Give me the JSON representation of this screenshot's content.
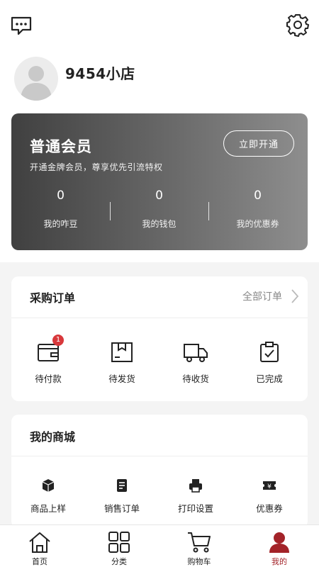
{
  "header": {
    "message_icon": "chat-bubble-icon",
    "settings_icon": "gear-icon"
  },
  "profile": {
    "shop_name": "9454小店",
    "avatar_icon": "default-avatar-icon"
  },
  "member_card": {
    "title": "普通会员",
    "subtitle": "开通金牌会员，尊享优先引流特权",
    "cta_label": "立即开通",
    "stats": [
      {
        "value": "0",
        "label": "我的咋豆"
      },
      {
        "value": "0",
        "label": "我的钱包"
      },
      {
        "value": "0",
        "label": "我的优惠券"
      }
    ]
  },
  "purchase_orders": {
    "title": "采购订单",
    "all_label": "全部订单",
    "items": [
      {
        "label": "待付款",
        "icon": "wallet-icon",
        "badge": "1"
      },
      {
        "label": "待发货",
        "icon": "box-icon"
      },
      {
        "label": "待收货",
        "icon": "truck-icon"
      },
      {
        "label": "已完成",
        "icon": "clipboard-check-icon"
      }
    ]
  },
  "my_mall": {
    "title": "我的商城",
    "items": [
      {
        "label": "商品上样",
        "icon": "cube-icon"
      },
      {
        "label": "销售订单",
        "icon": "document-icon"
      },
      {
        "label": "打印设置",
        "icon": "printer-icon"
      },
      {
        "label": "优惠券",
        "icon": "coupon-icon"
      }
    ]
  },
  "tabbar": {
    "active_color": "#a32329",
    "items": [
      {
        "label": "首页",
        "icon": "home-icon"
      },
      {
        "label": "分类",
        "icon": "grid-icon"
      },
      {
        "label": "购物车",
        "icon": "cart-icon"
      },
      {
        "label": "我的",
        "icon": "user-icon"
      }
    ]
  }
}
